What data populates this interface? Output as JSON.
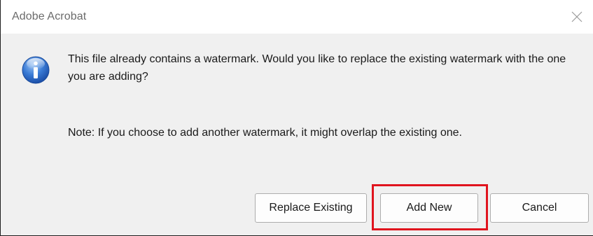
{
  "window": {
    "title": "Adobe Acrobat",
    "close_icon": "close-x-icon"
  },
  "message": {
    "icon": "info-icon",
    "text": "This file already contains a watermark. Would you like to replace the existing watermark with the one you are adding?",
    "note": "Note: If you choose to add another watermark, it might overlap the existing one."
  },
  "buttons": {
    "replace_label": "Replace Existing",
    "add_label": "Add New",
    "cancel_label": "Cancel"
  },
  "annotation": {
    "highlight_color": "#e0141e",
    "highlighted_button": "Add New"
  }
}
